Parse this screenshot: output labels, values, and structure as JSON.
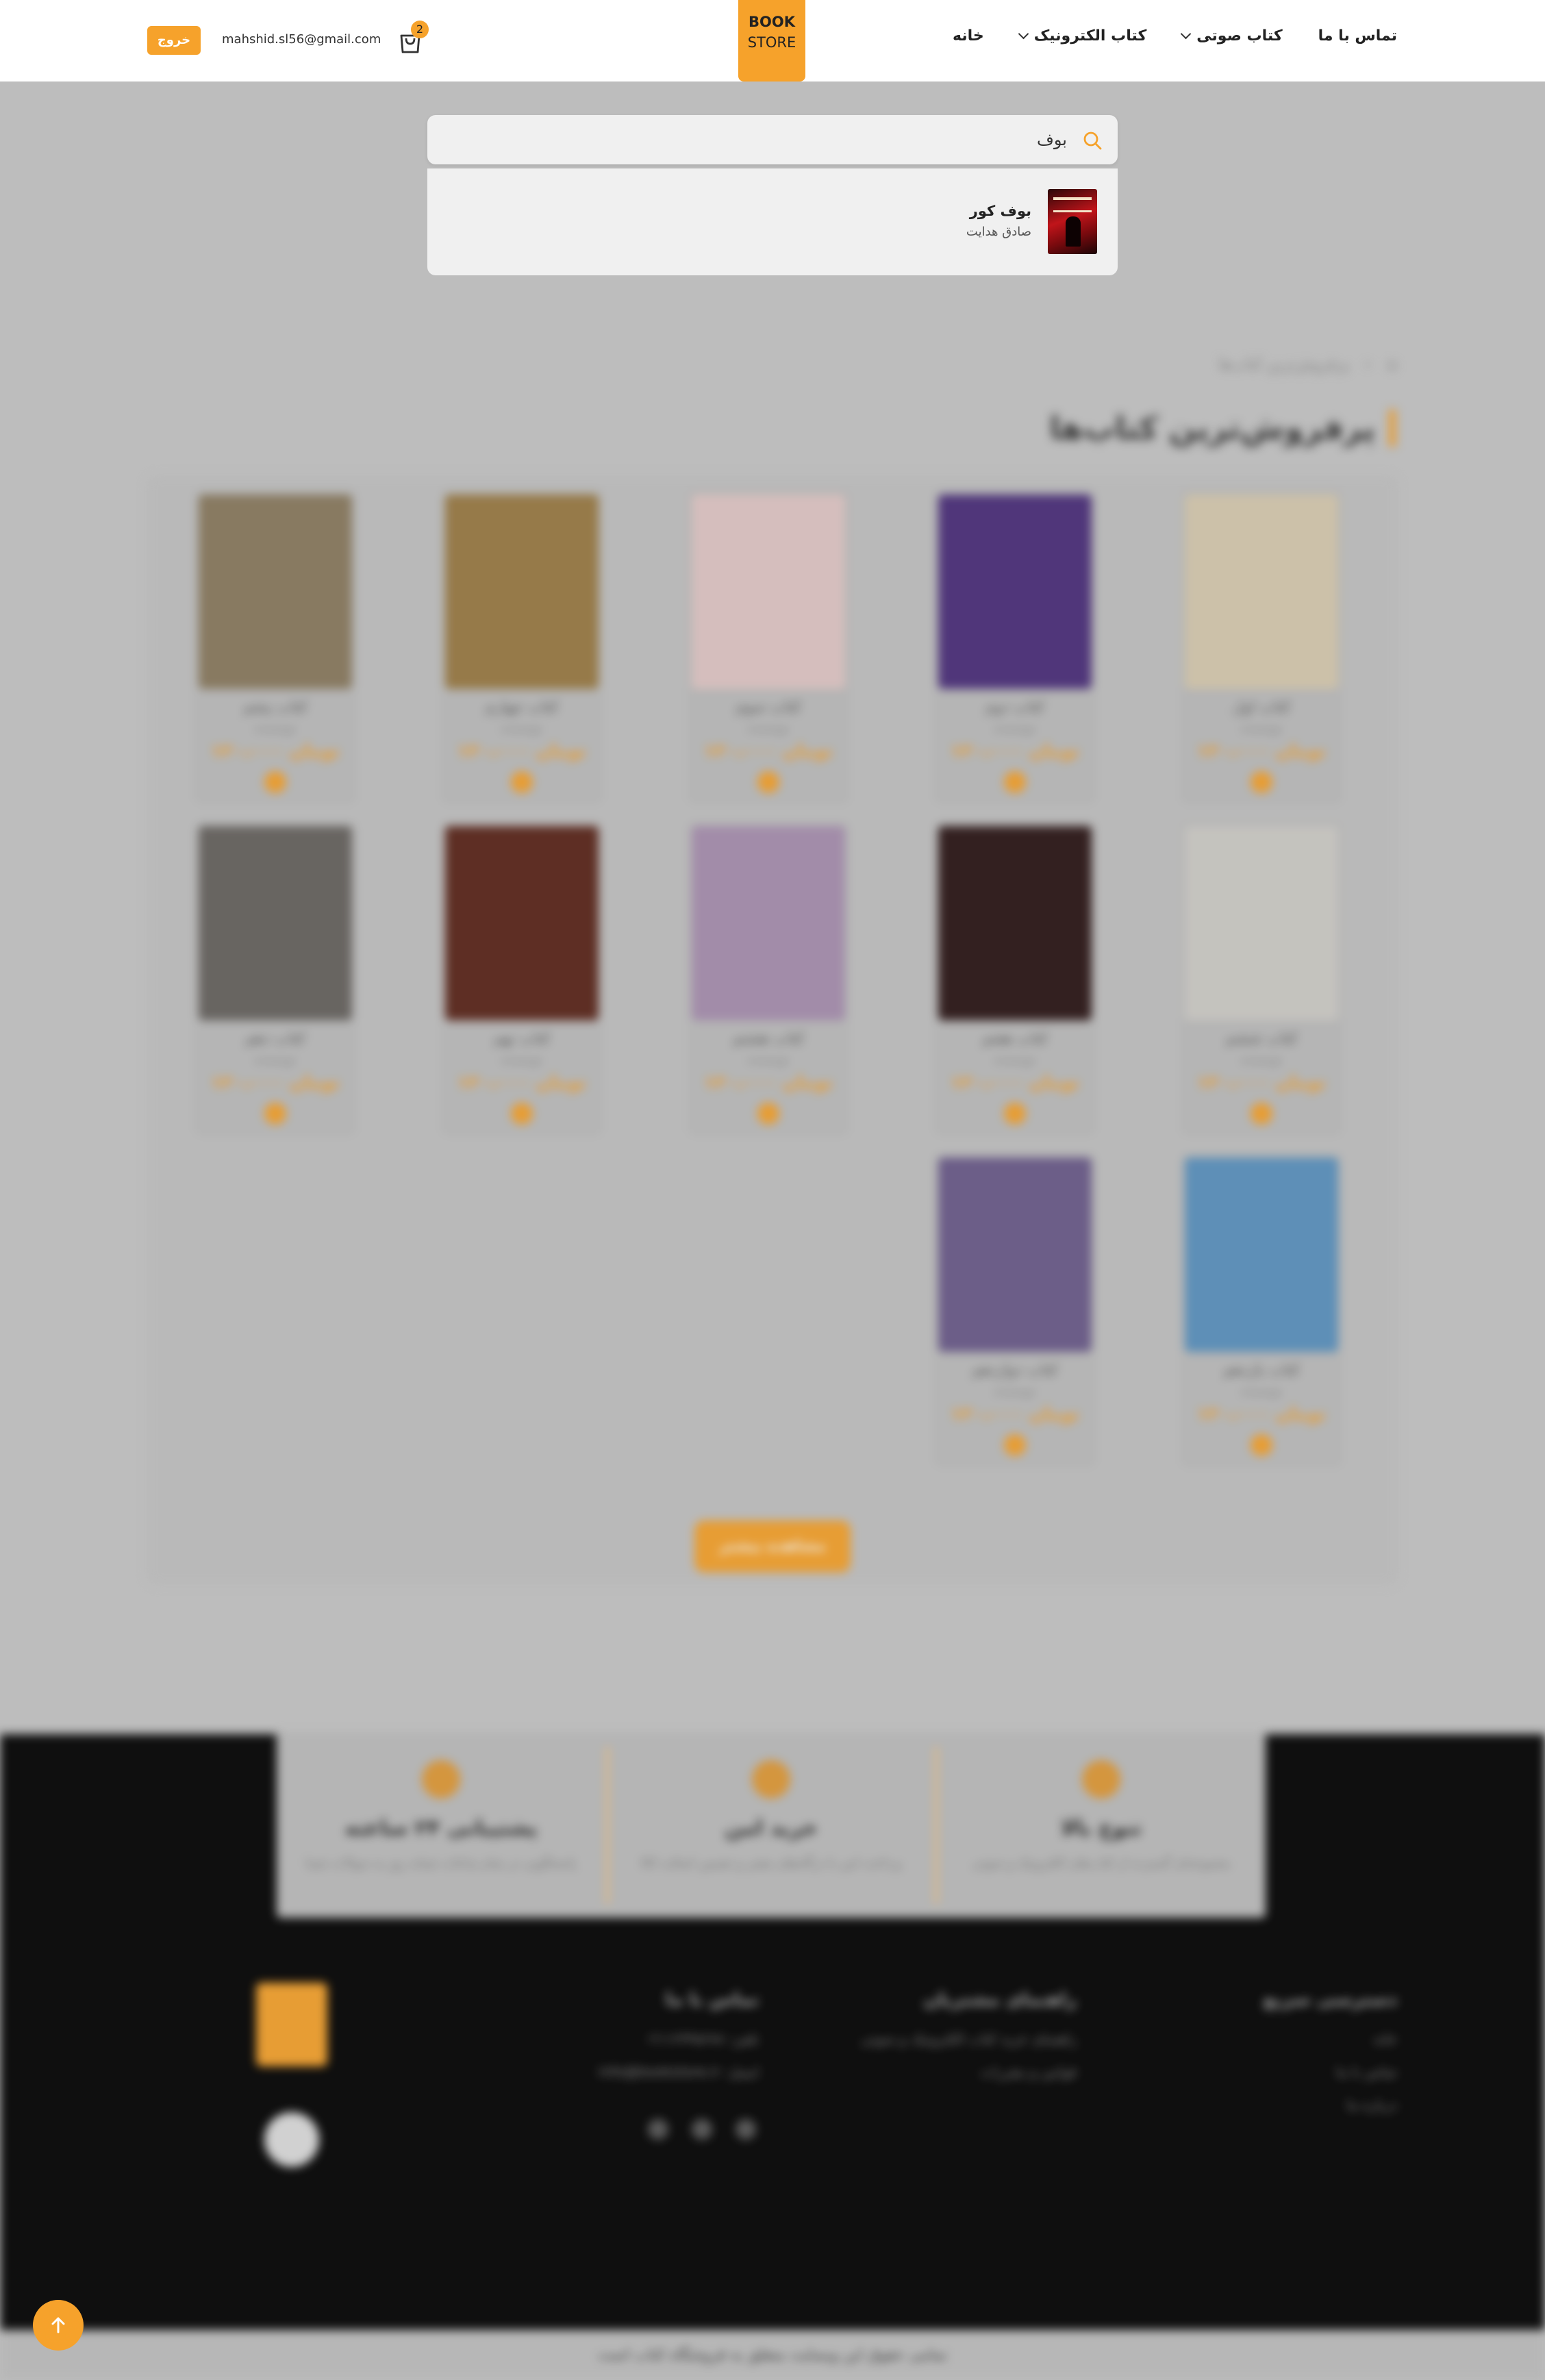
{
  "header": {
    "logo_line1": "BOOK",
    "logo_line2": "STORE",
    "nav": [
      {
        "label": "خانه",
        "has_dropdown": false
      },
      {
        "label": "کتاب الکترونیک",
        "has_dropdown": true
      },
      {
        "label": "کتاب صوتی",
        "has_dropdown": true
      },
      {
        "label": "تماس با ما",
        "has_dropdown": false
      }
    ],
    "cart_count": "2",
    "user_email": "mahshid.sl56@gmail.com",
    "logout_label": "خروج"
  },
  "search": {
    "query": "بوف",
    "results": [
      {
        "title": "بوف کور",
        "author": "صادق هدایت"
      }
    ]
  },
  "page": {
    "breadcrumb": [
      "خانه",
      "پرفروش‌ترین کتاب‌ها"
    ],
    "section_title": "پرفروش‌ترین کتاب‌ها",
    "books": [
      {
        "title": "کتاب اول",
        "author": "نویسنده",
        "price": "۱۲۰،۰۰۰ تومان"
      },
      {
        "title": "کتاب دوم",
        "author": "نویسنده",
        "price": "۱۲۰،۰۰۰ تومان"
      },
      {
        "title": "کتاب سوم",
        "author": "نویسنده",
        "price": "۱۲۰،۰۰۰ تومان"
      },
      {
        "title": "کتاب چهارم",
        "author": "نویسنده",
        "price": "۱۲۰،۰۰۰ تومان"
      },
      {
        "title": "کتاب پنجم",
        "author": "نویسنده",
        "price": "۱۲۰،۰۰۰ تومان"
      },
      {
        "title": "کتاب ششم",
        "author": "نویسنده",
        "price": "۱۲۰،۰۰۰ تومان"
      },
      {
        "title": "کتاب هفتم",
        "author": "نویسنده",
        "price": "۱۲۰،۰۰۰ تومان"
      },
      {
        "title": "کتاب هشتم",
        "author": "نویسنده",
        "price": "۱۲۰،۰۰۰ تومان"
      },
      {
        "title": "کتاب نهم",
        "author": "نویسنده",
        "price": "۱۲۰،۰۰۰ تومان"
      },
      {
        "title": "کتاب دهم",
        "author": "نویسنده",
        "price": "۱۲۰،۰۰۰ تومان"
      },
      {
        "title": "کتاب یازدهم",
        "author": "نویسنده",
        "price": "۱۲۰،۰۰۰ تومان"
      },
      {
        "title": "کتاب دوازدهم",
        "author": "نویسنده",
        "price": "۱۲۰،۰۰۰ تومان"
      }
    ],
    "more_label": "مشاهده بیشتر"
  },
  "features": [
    {
      "title": "پشتیبانی ۲۴ ساعته",
      "desc": "پاسخگویی در تمام ساعات شبانه روز به سوالات شما"
    },
    {
      "title": "خرید امن",
      "desc": "پرداخت امن با درگاه‌های معتبر و تضمین اصالت کالا"
    },
    {
      "title": "تنوع بالا",
      "desc": "مجموعه‌ای گسترده از کتاب‌های الکترونیک و صوتی"
    }
  ],
  "footer": {
    "col1": {
      "heading": "دسترسی سریع",
      "links": [
        "خانه",
        "تماس با ما",
        "درباره ما"
      ]
    },
    "col2": {
      "heading": "راهنمای مشتریان",
      "links": [
        "راهنمای خرید کتاب الکترونیک و صوتی",
        "قوانین و مقررات"
      ]
    },
    "col3": {
      "heading": "تماس با ما",
      "links": [
        "تلفن: ۰۲۱۱۲۳۴۵۶۷۸",
        "ایمیل: info@bookstore.ir"
      ]
    },
    "copyright": "تمامی حقوق این وبسایت متعلق به فروشگاه کتاب است"
  },
  "colors": {
    "accent": "#f6a22b",
    "overlay": "#c6c6c6"
  }
}
